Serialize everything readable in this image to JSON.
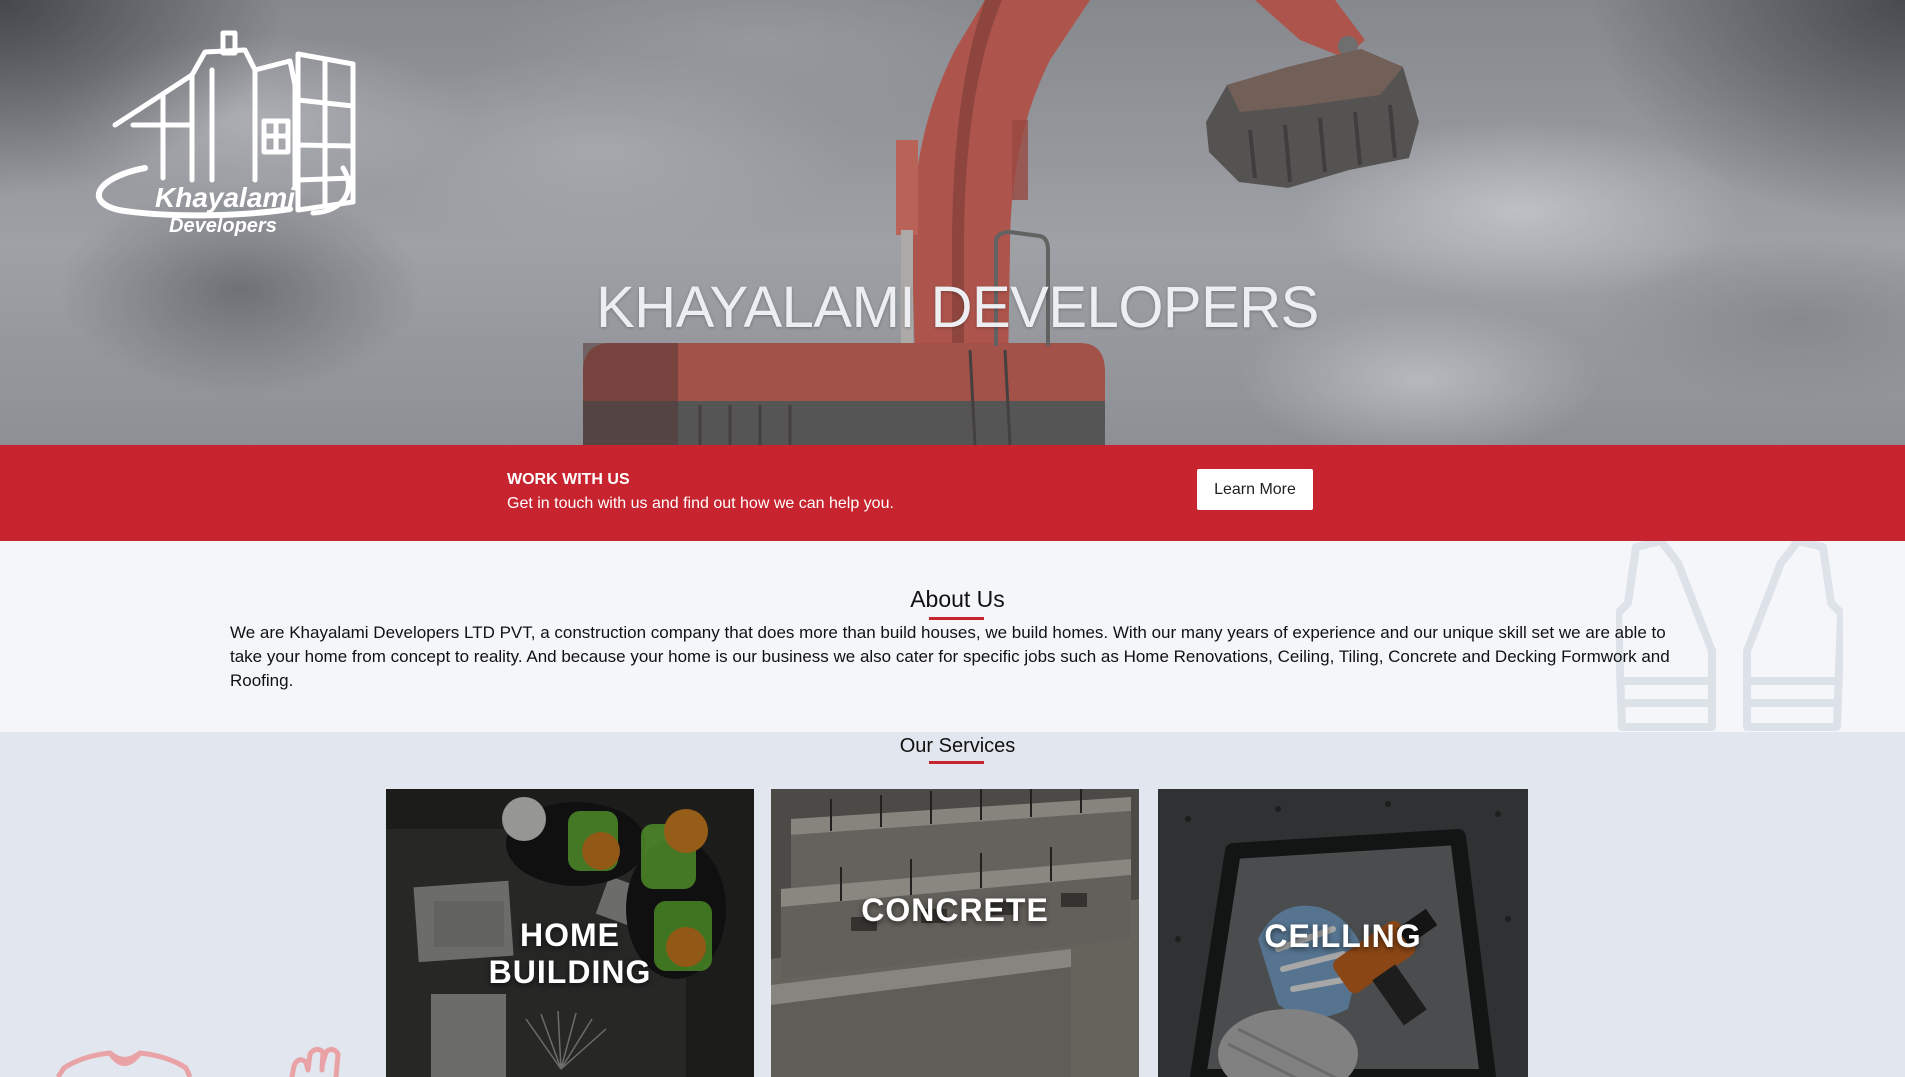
{
  "colors": {
    "accent": "#c8242f",
    "about_bg": "#f4f6fa",
    "services_bg": "#e2e6ee",
    "button_bg": "#ffffff"
  },
  "hero": {
    "logo": {
      "line1": "Khayalami",
      "line2": "Developers"
    },
    "title": "KHAYALAMI DEVELOPERS"
  },
  "cta": {
    "heading": "WORK WITH US",
    "text": "Get in touch with us and find out how we can help you.",
    "button_label": "Learn More"
  },
  "about": {
    "heading": "About Us",
    "body": "We are Khayalami Developers LTD PVT, a construction company that does more than build houses, we build homes. With our many years of experience and our unique skill set we are able to take your home from concept to reality. And because your home is our business we also cater for specific jobs such as Home Renovations, Ceiling, Tiling, Concrete and Decking Formwork and Roofing.",
    "decor_icon": "safety-vest-icon"
  },
  "services": {
    "heading": "Our Services",
    "items": [
      {
        "label": "HOME BUILDING"
      },
      {
        "label": "CONCRETE"
      },
      {
        "label": "CEILLING"
      }
    ]
  },
  "decor_icons": [
    "shirt-icon",
    "glove-icon"
  ]
}
